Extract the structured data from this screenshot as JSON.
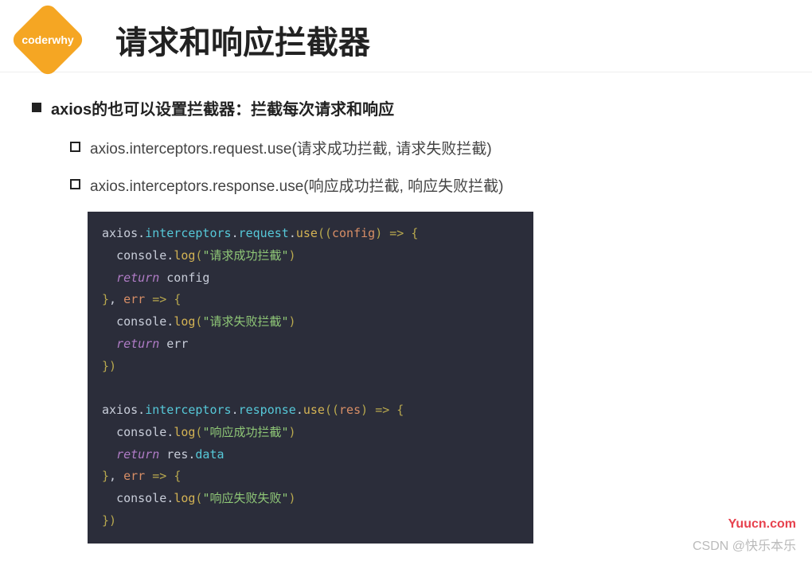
{
  "header": {
    "badge": "coderwhy",
    "title": "请求和响应拦截器"
  },
  "main": {
    "bullet": "axios的也可以设置拦截器：拦截每次请求和响应",
    "sub_bullets": [
      "axios.interceptors.request.use(请求成功拦截, 请求失败拦截)",
      "axios.interceptors.response.use(响应成功拦截, 响应失败拦截)"
    ]
  },
  "code": {
    "line1_a": "axios",
    "line1_b": "interceptors",
    "line1_c": "request",
    "line1_d": "use",
    "line1_e": "config",
    "line2_a": "console",
    "line2_b": "log",
    "line2_c": "\"请求成功拦截\"",
    "line3_a": "return",
    "line3_b": "config",
    "line4_a": "err",
    "line5_a": "console",
    "line5_b": "log",
    "line5_c": "\"请求失败拦截\"",
    "line6_a": "return",
    "line6_b": "err",
    "line8_a": "axios",
    "line8_b": "interceptors",
    "line8_c": "response",
    "line8_d": "use",
    "line8_e": "res",
    "line9_a": "console",
    "line9_b": "log",
    "line9_c": "\"响应成功拦截\"",
    "line10_a": "return",
    "line10_b": "res",
    "line10_c": "data",
    "line11_a": "err",
    "line12_a": "console",
    "line12_b": "log",
    "line12_c": "\"响应失败失败\""
  },
  "watermark": {
    "url": "Yuucn.com",
    "csdn": "CSDN @快乐本乐"
  }
}
